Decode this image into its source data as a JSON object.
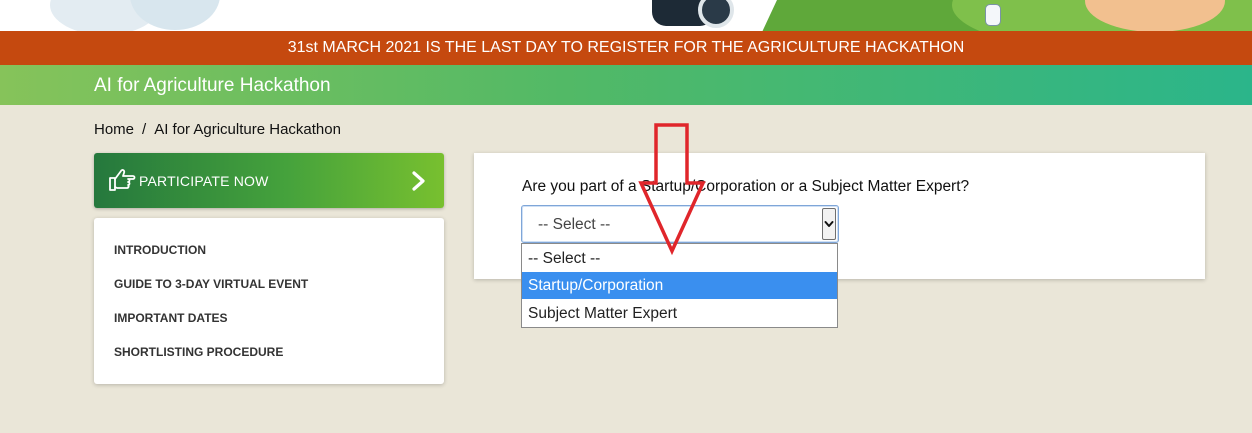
{
  "announcement": "31st MARCH 2021 IS THE LAST DAY TO REGISTER FOR THE AGRICULTURE HACKATHON",
  "page_title": "AI for Agriculture Hackathon",
  "breadcrumb": {
    "home": "Home",
    "separator": "/",
    "current": "AI for Agriculture Hackathon"
  },
  "cta": {
    "label": "PARTICIPATE NOW",
    "icon": "pointing-hand-icon",
    "chevron_icon": "chevron-right-icon"
  },
  "sidebar": {
    "items": [
      {
        "label": "INTRODUCTION"
      },
      {
        "label": "GUIDE TO 3-DAY VIRTUAL EVENT"
      },
      {
        "label": "IMPORTANT DATES"
      },
      {
        "label": "SHORTLISTING PROCEDURE"
      }
    ]
  },
  "form": {
    "question": "Are you part of a Startup/Corporation or a Subject Matter Expert?",
    "select_value": "-- Select --",
    "options": [
      {
        "label": "-- Select --"
      },
      {
        "label": "Startup/Corporation",
        "highlighted": true
      },
      {
        "label": "Subject Matter Expert"
      }
    ]
  },
  "colors": {
    "announcement_bg": "#c5490f",
    "title_gradient": [
      "#86c35a",
      "#2bb58a"
    ],
    "cta_gradient": [
      "#25783d",
      "#78c02f"
    ],
    "highlight": "#3a8fef",
    "annotation_arrow": "#e0262b",
    "page_bg": "#eae6d8"
  }
}
